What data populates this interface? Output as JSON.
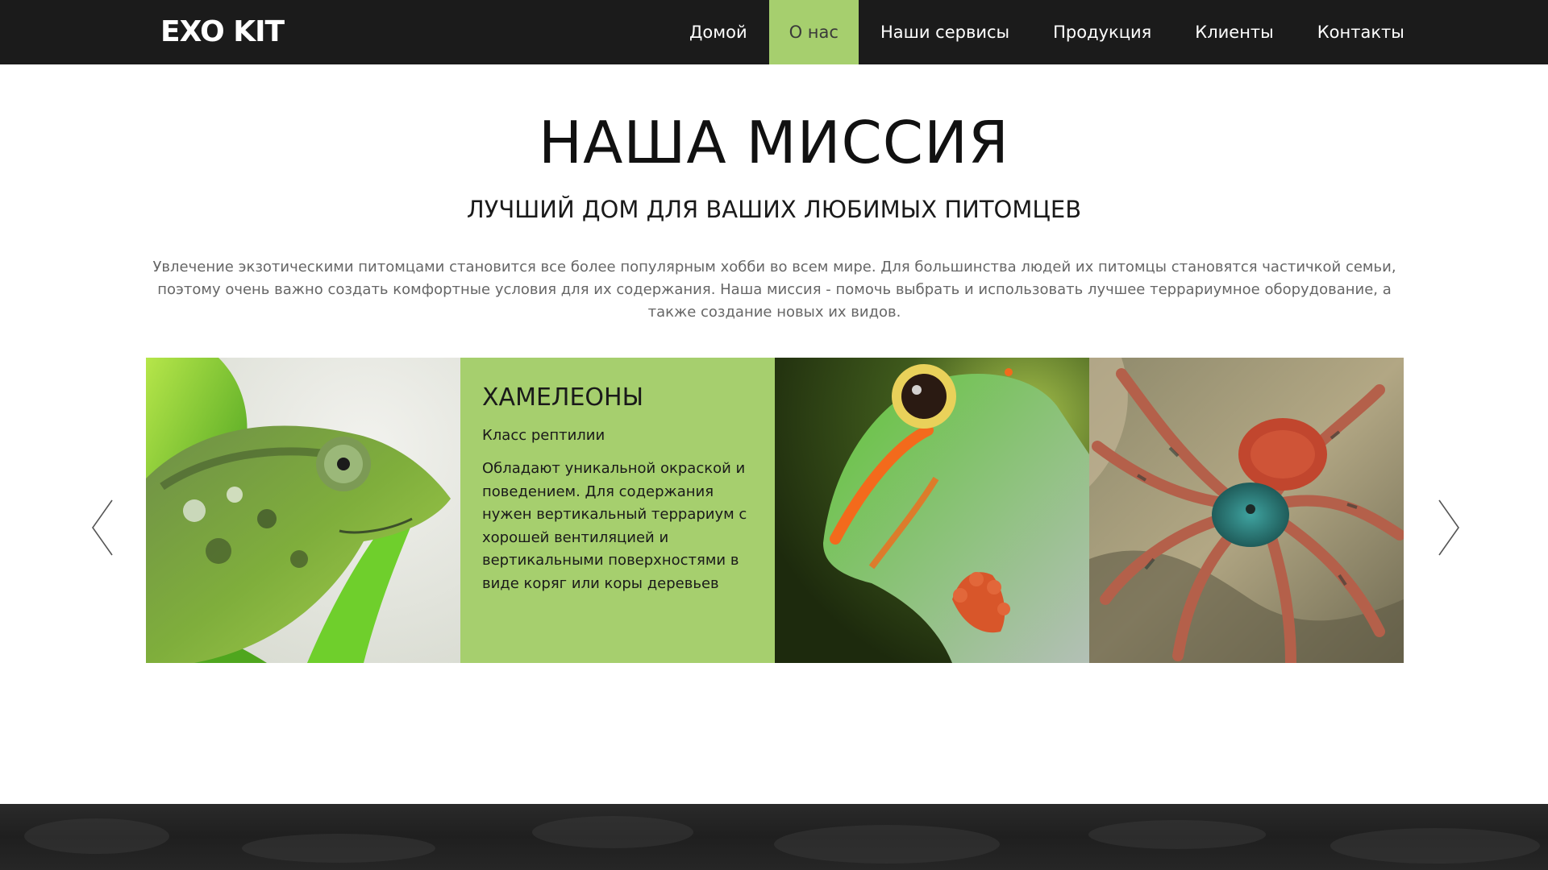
{
  "brand": {
    "logo": "EXO KIT"
  },
  "nav": {
    "items": [
      {
        "label": "Домой"
      },
      {
        "label": "О нас"
      },
      {
        "label": "Наши сервисы"
      },
      {
        "label": "Продукция"
      },
      {
        "label": "Клиенты"
      },
      {
        "label": "Контакты"
      }
    ],
    "active": "О нас"
  },
  "mission": {
    "title": "НАША МИССИЯ",
    "subtitle": "ЛУЧШИЙ ДОМ ДЛЯ ВАШИХ ЛЮБИМЫХ ПИТОМЦЕВ",
    "text": "Увлечение экзотическими питомцами становится все более популярным хобби во всем мире. Для большинства людей их питомцы становятся частичкой семьи, поэтому очень важно создать комфортные условия для их содержания. Наша миссия - помочь выбрать и использовать лучшее террариумное оборудование, а также создание новых их видов."
  },
  "slider": {
    "card": {
      "title": "ХАМЕЛЕОНЫ",
      "class": "Класс рептилии",
      "description": "Обладают уникальной окраской и поведением. Для содержания нужен вертикальный террариум с хорошей вентиляцией и вертикальными поверхностями в виде коряг или коры деревьев"
    },
    "prev_icon": "chevron-left-icon",
    "next_icon": "chevron-right-icon"
  },
  "colors": {
    "nav_bg": "#1b1b1b",
    "accent": "#a6cf6e",
    "text_muted": "#666666"
  }
}
